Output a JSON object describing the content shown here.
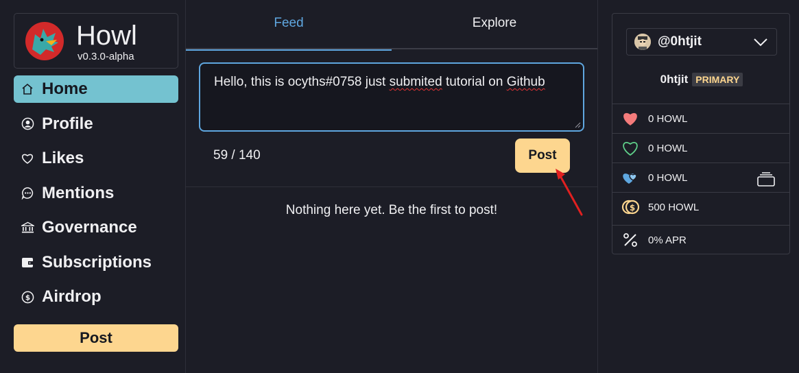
{
  "brand": {
    "name": "Howl",
    "version": "v0.3.0-alpha"
  },
  "sidebar": {
    "items": [
      {
        "label": "Home",
        "icon": "home-icon",
        "active": true
      },
      {
        "label": "Profile",
        "icon": "profile-icon",
        "active": false
      },
      {
        "label": "Likes",
        "icon": "heart-icon",
        "active": false
      },
      {
        "label": "Mentions",
        "icon": "chat-bubble-icon",
        "active": false
      },
      {
        "label": "Governance",
        "icon": "bank-icon",
        "active": false
      },
      {
        "label": "Subscriptions",
        "icon": "wallet-icon",
        "active": false
      },
      {
        "label": "Airdrop",
        "icon": "coin-icon",
        "active": false
      }
    ],
    "post_button": "Post"
  },
  "feed": {
    "tabs": [
      {
        "label": "Feed",
        "active": true
      },
      {
        "label": "Explore",
        "active": false
      }
    ],
    "composer": {
      "before": "Hello, this is ocyths#0758 just ",
      "misspelled_1": "submited",
      "middle": " tutorial on ",
      "misspelled_2": "Github"
    },
    "char_count": "59 / 140",
    "post_button": "Post",
    "empty_message": "Nothing here yet. Be the first to post!"
  },
  "account": {
    "handle": "@0htjit",
    "name": "0htjit",
    "badge": "PRIMARY",
    "stats": [
      {
        "icon": "filled-heart-icon",
        "value": "0 HOWL",
        "color": "#f47b7b"
      },
      {
        "icon": "outline-heart-icon",
        "value": "0 HOWL",
        "color": "#5fd08a"
      },
      {
        "icon": "hearts-icon",
        "value": "0 HOWL",
        "color": "#5fa7e0"
      },
      {
        "icon": "coins-icon",
        "value": "500 HOWL",
        "color": "#fdd68f"
      },
      {
        "icon": "percent-icon",
        "value": "0% APR",
        "color": "#f0f0f2"
      }
    ]
  },
  "colors": {
    "background": "#1c1d26",
    "accent": "#74c2d0",
    "highlight": "#fdd68f",
    "link": "#5fa7e0",
    "annotation_arrow": "#e02020"
  }
}
